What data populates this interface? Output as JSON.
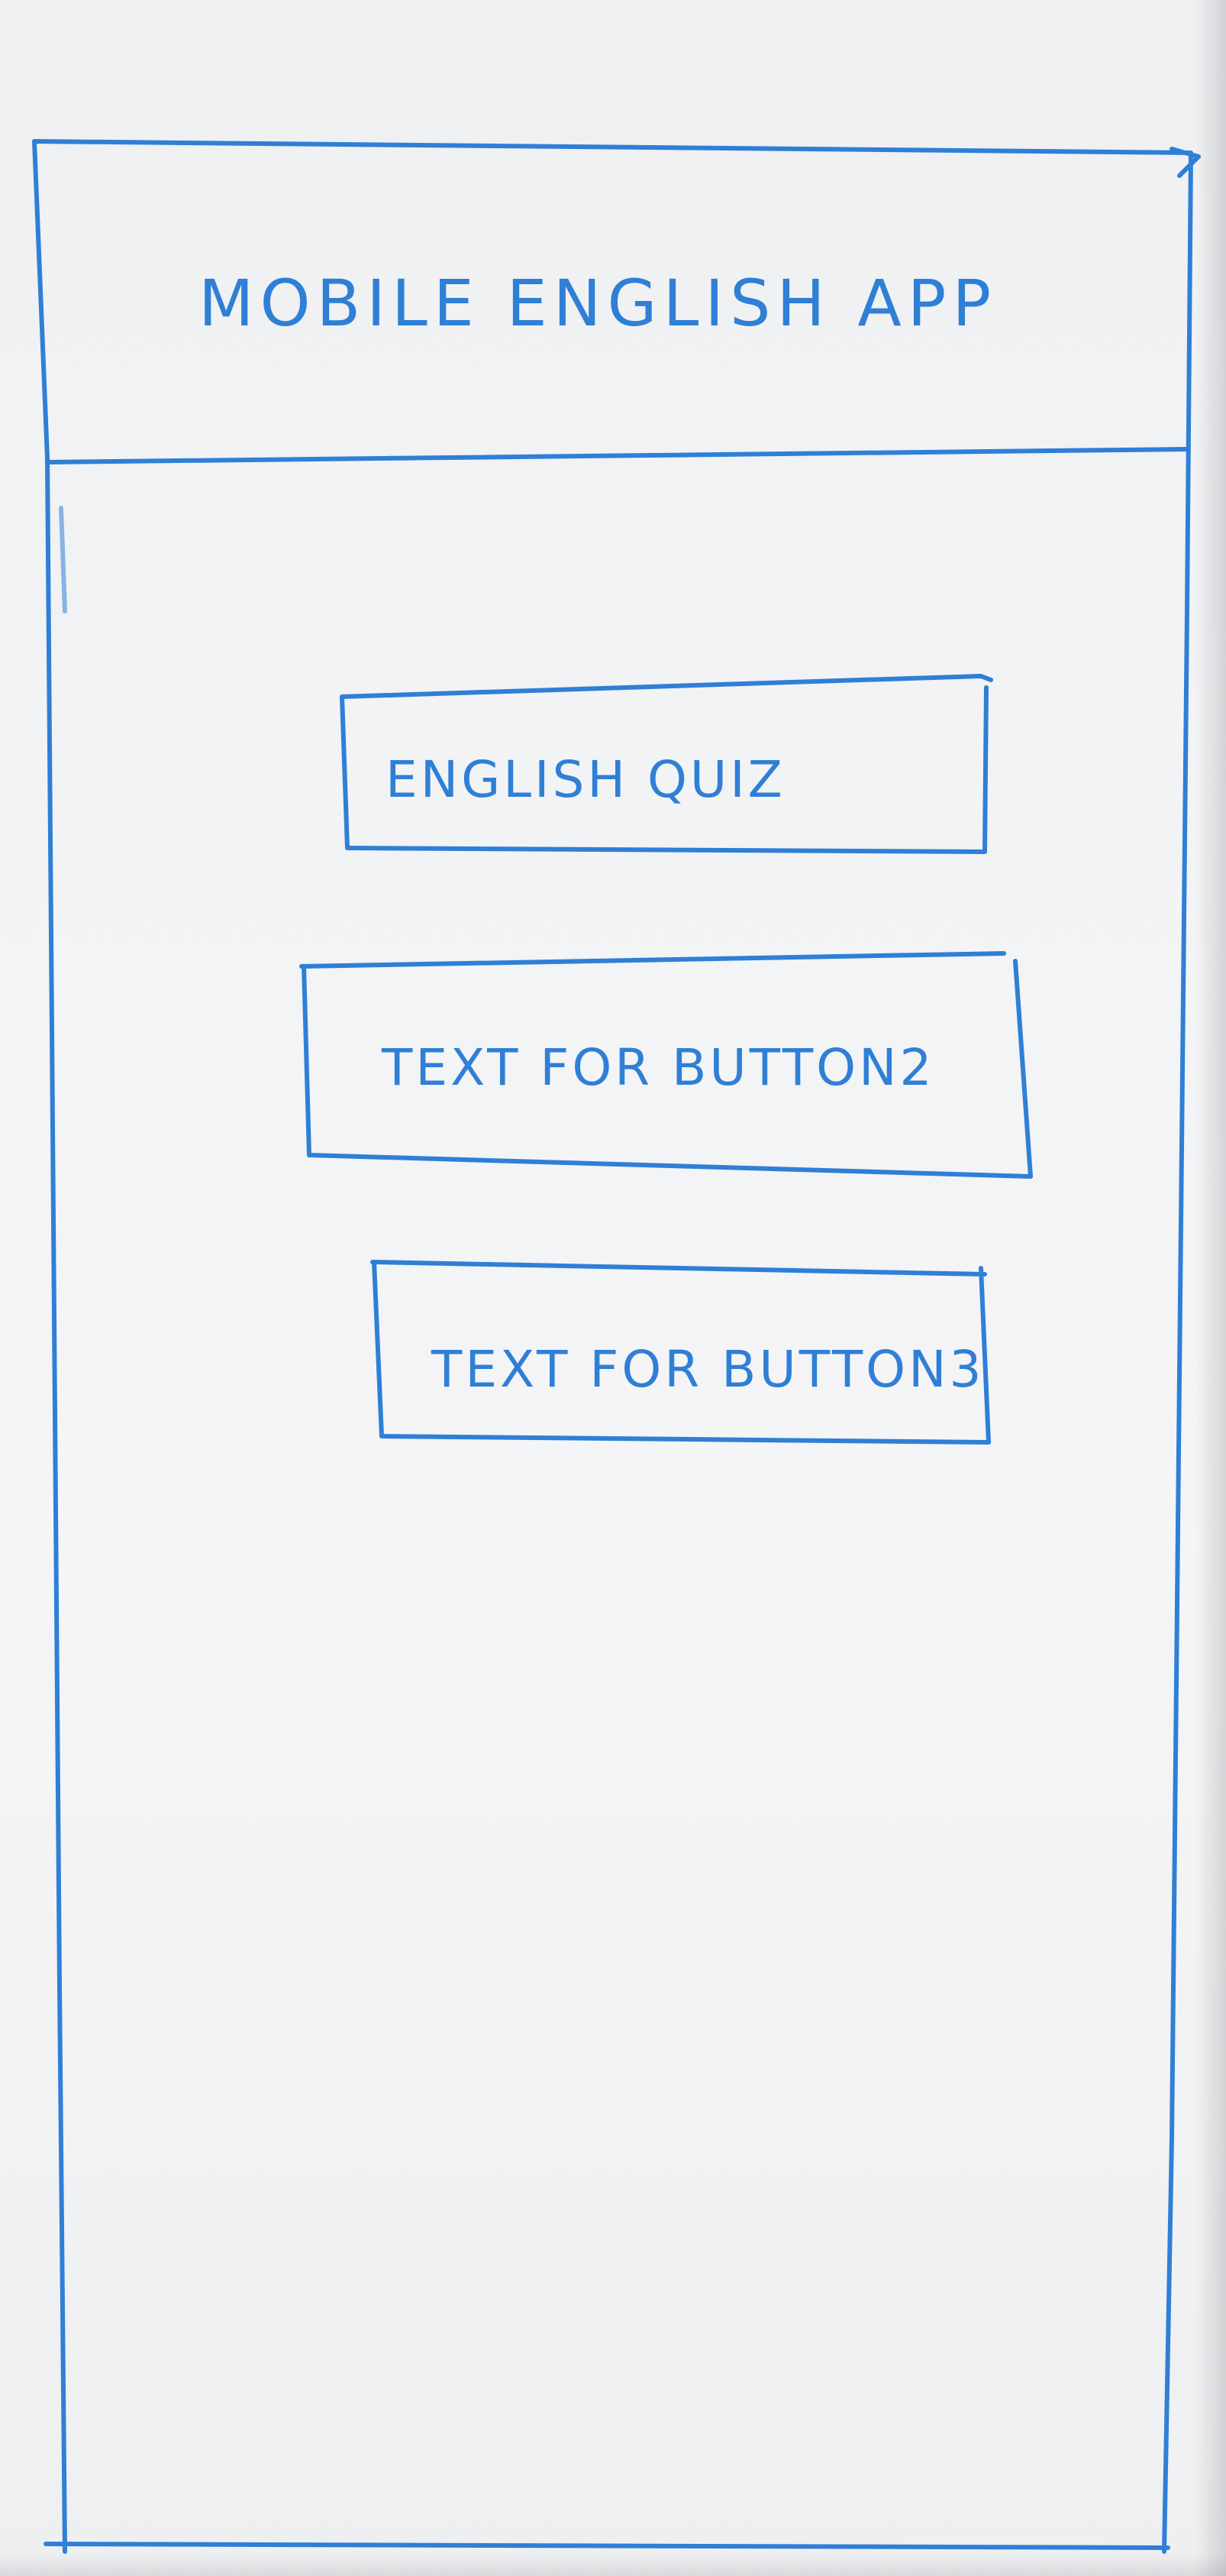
{
  "header": {
    "title": "MOBILE ENGLISH APP"
  },
  "buttons": [
    {
      "label": "ENGLISH QUIZ"
    },
    {
      "label": "TEXT FOR BUTTON2"
    },
    {
      "label": "TEXT FOR BUTTON3"
    }
  ],
  "colors": {
    "ink": "#2f7fd6",
    "paper": "#f2f3f5"
  }
}
